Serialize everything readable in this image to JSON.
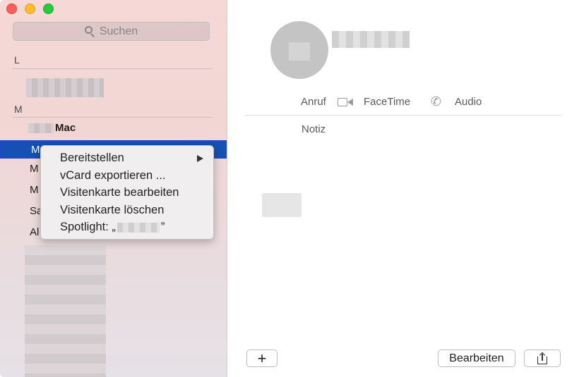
{
  "sidebar": {
    "search_placeholder": "Suchen",
    "sections": [
      {
        "letter": "L"
      },
      {
        "letter": "M"
      }
    ],
    "contacts": {
      "mac_row": "Mac",
      "selected_row": "M",
      "row_m1": "M",
      "row_m2": "M",
      "row_sa": "Sa",
      "row_al": "Al"
    }
  },
  "main": {
    "actions": {
      "call": "Anruf",
      "facetime": "FaceTime",
      "audio": "Audio"
    },
    "note_label": "Notiz",
    "buttons": {
      "add": "+",
      "edit": "Bearbeiten"
    }
  },
  "context_menu": {
    "items": [
      {
        "label": "Bereitstellen",
        "submenu": true
      },
      {
        "label": "vCard exportieren ..."
      },
      {
        "label": "Visitenkarte bearbeiten"
      },
      {
        "label": "Visitenkarte löschen"
      },
      {
        "label": "Spotlight: „",
        "suffix": "”"
      }
    ]
  },
  "colors": {
    "selection": "#1550b4",
    "close": "#fb5f57",
    "minimize": "#fdbc2e",
    "maximize": "#28c840"
  }
}
